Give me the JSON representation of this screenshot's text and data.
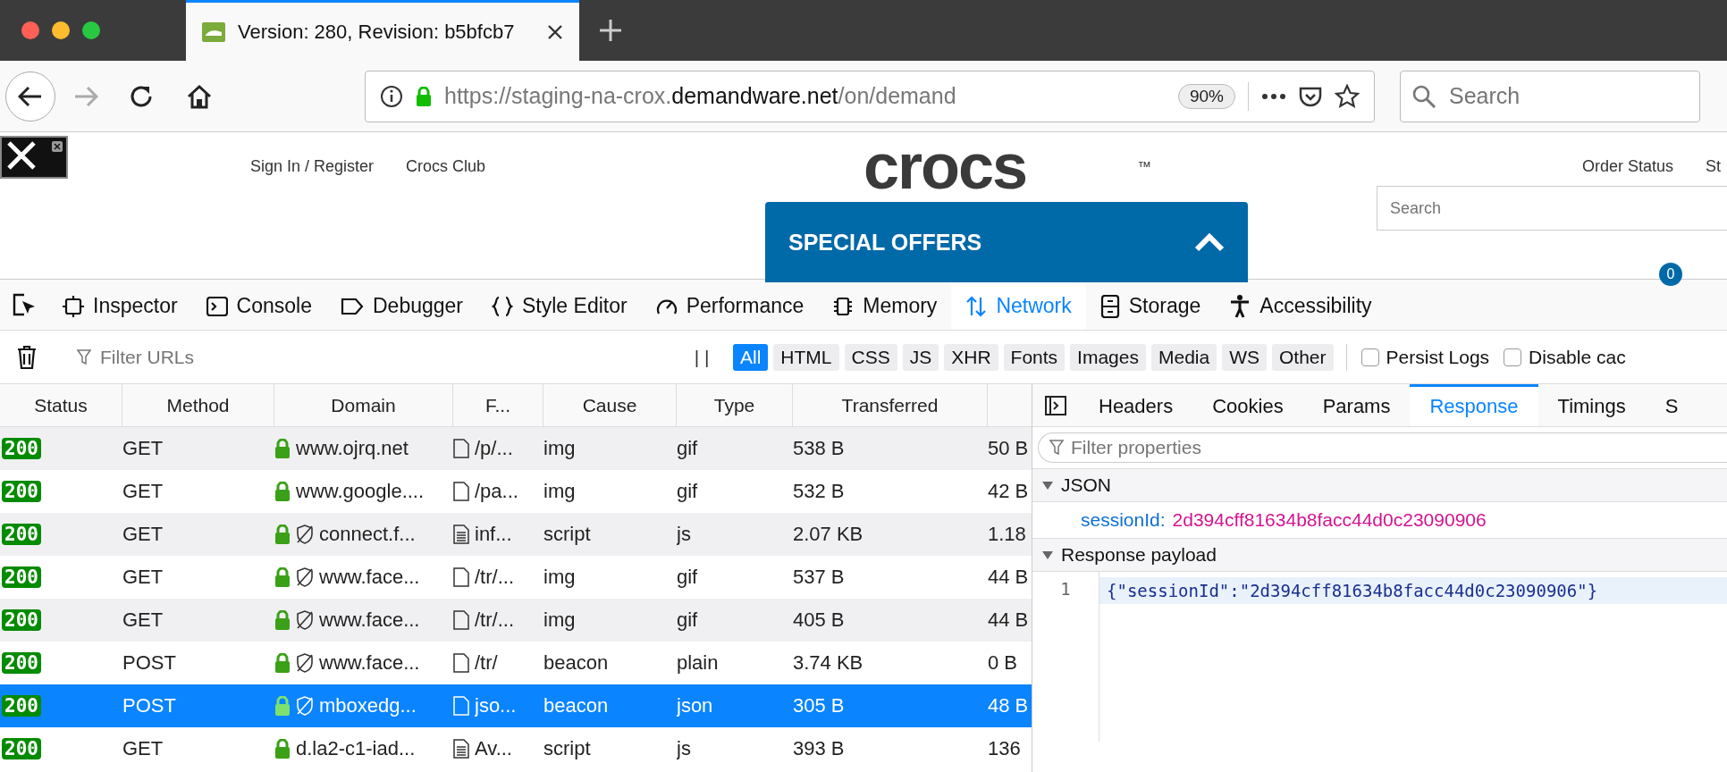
{
  "browser": {
    "tab": {
      "title": "Version: 280, Revision: b5bfcb7"
    },
    "url": {
      "prefix": "https://staging-na-crox.",
      "host": "demandware.net",
      "path": "/on/demand"
    },
    "zoom": "90%",
    "search": {
      "placeholder": "Search"
    }
  },
  "site": {
    "links_left": [
      "Sign In / Register",
      "Crocs Club"
    ],
    "logo": "crocs",
    "logo_mark": "™",
    "links_right": [
      "Order Status",
      "St"
    ],
    "search": {
      "placeholder": "Search"
    },
    "cart_count": "0",
    "offers": "SPECIAL OFFERS"
  },
  "devtools": {
    "tabs": [
      {
        "label": "Inspector",
        "selected": false
      },
      {
        "label": "Console",
        "selected": false
      },
      {
        "label": "Debugger",
        "selected": false
      },
      {
        "label": "Style Editor",
        "selected": false
      },
      {
        "label": "Performance",
        "selected": false
      },
      {
        "label": "Memory",
        "selected": false
      },
      {
        "label": "Network",
        "selected": true
      },
      {
        "label": "Storage",
        "selected": false
      },
      {
        "label": "Accessibility",
        "selected": false
      }
    ],
    "filter": {
      "placeholder": "Filter URLs"
    },
    "pause": "| |",
    "chips": [
      {
        "label": "All",
        "selected": true
      },
      {
        "label": "HTML",
        "selected": false
      },
      {
        "label": "CSS",
        "selected": false
      },
      {
        "label": "JS",
        "selected": false
      },
      {
        "label": "XHR",
        "selected": false
      },
      {
        "label": "Fonts",
        "selected": false
      },
      {
        "label": "Images",
        "selected": false
      },
      {
        "label": "Media",
        "selected": false
      },
      {
        "label": "WS",
        "selected": false
      },
      {
        "label": "Other",
        "selected": false
      }
    ],
    "options": [
      {
        "label": "Persist Logs",
        "checked": false
      },
      {
        "label": "Disable cac",
        "checked": false
      }
    ],
    "columns": [
      "Status",
      "Method",
      "Domain",
      "F...",
      "Cause",
      "Type",
      "Transferred"
    ],
    "rows": [
      {
        "status": "200",
        "method": "GET",
        "tracker": false,
        "kind": "blank",
        "domain": "www.ojrq.net",
        "file": "/p/...",
        "cause": "img",
        "type": "gif",
        "transferred": "538 B",
        "size": "50 B",
        "selected": false
      },
      {
        "status": "200",
        "method": "GET",
        "tracker": false,
        "kind": "blank",
        "domain": "www.google....",
        "file": "/pa...",
        "cause": "img",
        "type": "gif",
        "transferred": "532 B",
        "size": "42 B",
        "selected": false
      },
      {
        "status": "200",
        "method": "GET",
        "tracker": true,
        "kind": "text",
        "domain": "connect.f...",
        "file": "inf...",
        "cause": "script",
        "type": "js",
        "transferred": "2.07 KB",
        "size": "1.18",
        "selected": false
      },
      {
        "status": "200",
        "method": "GET",
        "tracker": true,
        "kind": "blank",
        "domain": "www.face...",
        "file": "/tr/...",
        "cause": "img",
        "type": "gif",
        "transferred": "537 B",
        "size": "44 B",
        "selected": false
      },
      {
        "status": "200",
        "method": "GET",
        "tracker": true,
        "kind": "blank",
        "domain": "www.face...",
        "file": "/tr/...",
        "cause": "img",
        "type": "gif",
        "transferred": "405 B",
        "size": "44 B",
        "selected": false
      },
      {
        "status": "200",
        "method": "POST",
        "tracker": true,
        "kind": "blank",
        "domain": "www.face...",
        "file": "/tr/",
        "cause": "beacon",
        "type": "plain",
        "transferred": "3.74 KB",
        "size": "0 B",
        "selected": false
      },
      {
        "status": "200",
        "method": "POST",
        "tracker": true,
        "kind": "blank",
        "domain": "mboxedg...",
        "file": "jso...",
        "cause": "beacon",
        "type": "json",
        "transferred": "305 B",
        "size": "48 B",
        "selected": true
      },
      {
        "status": "200",
        "method": "GET",
        "tracker": false,
        "kind": "text",
        "domain": "d.la2-c1-iad...",
        "file": "Av...",
        "cause": "script",
        "type": "js",
        "transferred": "393 B",
        "size": "136",
        "selected": false
      }
    ],
    "details": {
      "tabs": [
        {
          "label": "Headers",
          "selected": false
        },
        {
          "label": "Cookies",
          "selected": false
        },
        {
          "label": "Params",
          "selected": false
        },
        {
          "label": "Response",
          "selected": true
        },
        {
          "label": "Timings",
          "selected": false
        },
        {
          "label": "S",
          "selected": false
        }
      ],
      "filter": {
        "placeholder": "Filter properties"
      },
      "sections": [
        {
          "title": "JSON",
          "expanded": true
        },
        {
          "title": "Response payload",
          "expanded": true
        }
      ],
      "json_key": "sessionId:",
      "json_value": "2d394cff81634b8facc44d0c23090906",
      "line_number": "1",
      "code": "{\"sessionId\":\"2d394cff81634b8facc44d0c23090906\"}"
    }
  }
}
